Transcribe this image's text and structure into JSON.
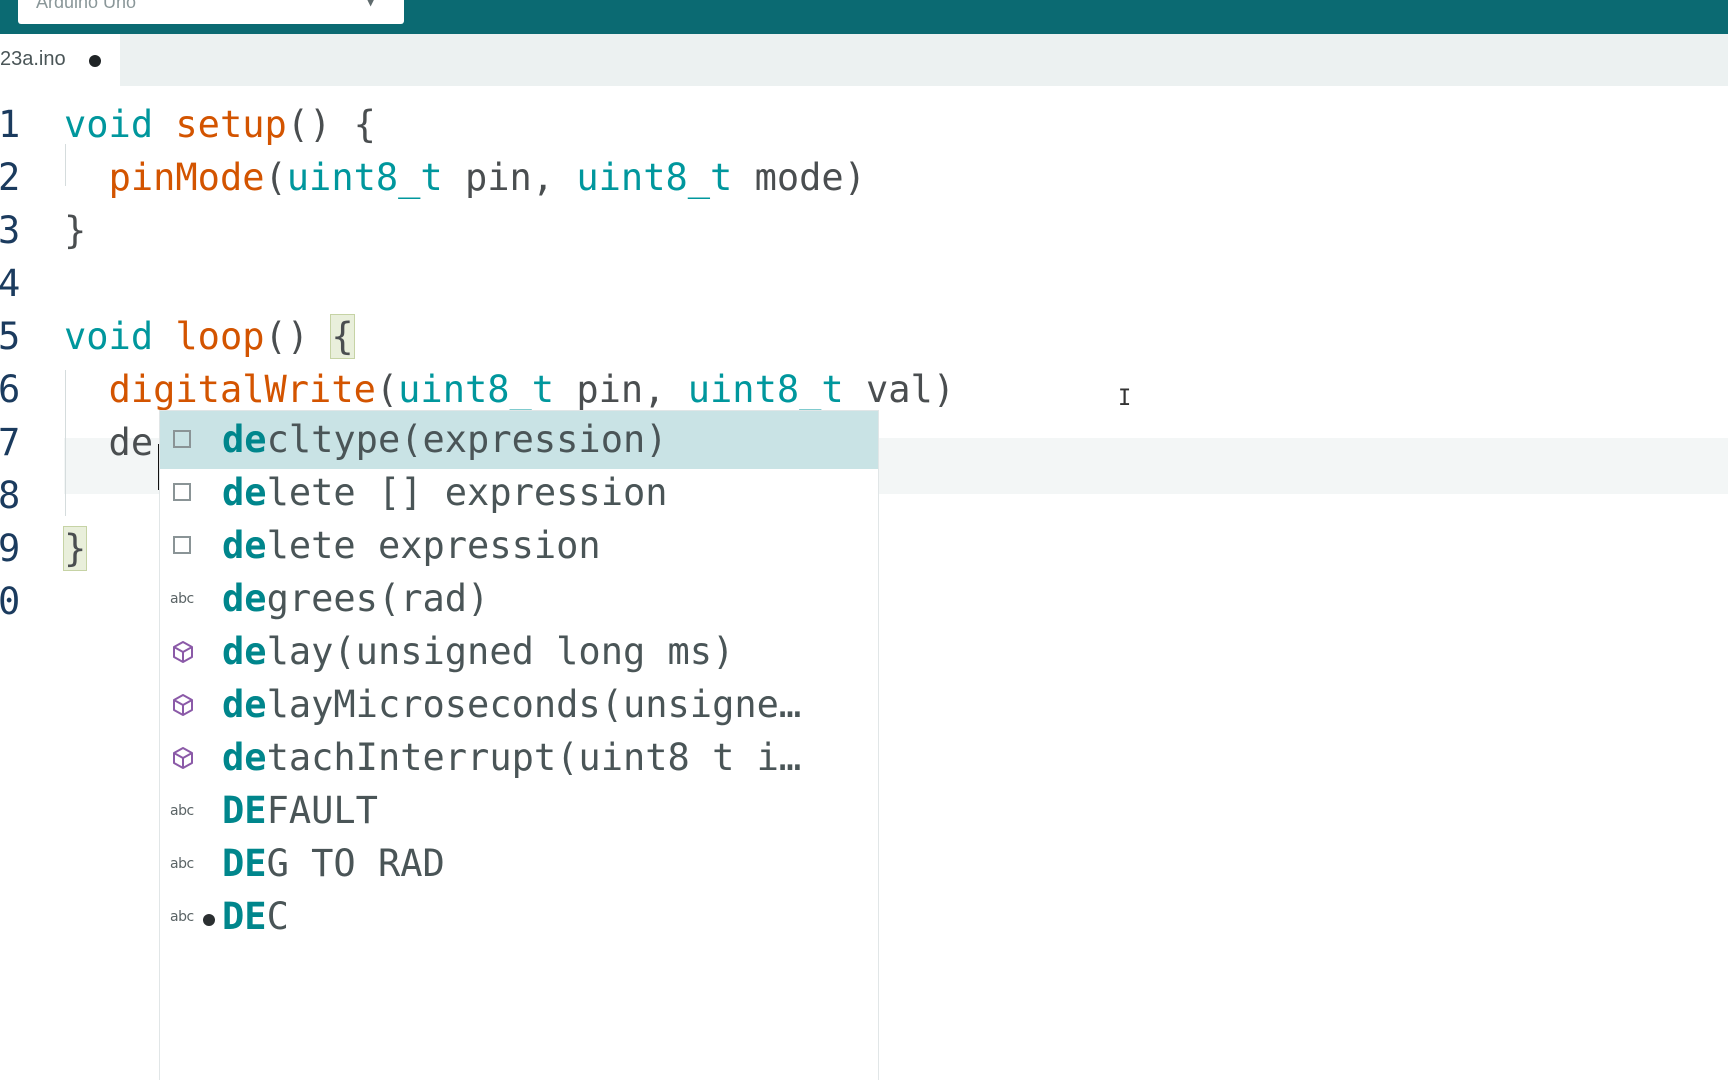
{
  "toolbar": {
    "board_label": "Arduino Uno"
  },
  "tabs": [
    {
      "label": "23a.ino",
      "modified": true
    }
  ],
  "editor": {
    "line_numbers": [
      "1",
      "2",
      "3",
      "4",
      "5",
      "6",
      "7",
      "8",
      "9",
      "0"
    ],
    "lines": [
      {
        "tokens": [
          {
            "t": "void",
            "c": "kw"
          },
          {
            "t": " ",
            "c": "tx"
          },
          {
            "t": "setup",
            "c": "fn"
          },
          {
            "t": "() {",
            "c": "tx"
          }
        ]
      },
      {
        "tokens": [
          {
            "t": "  ",
            "c": "tx"
          },
          {
            "t": "pinMode",
            "c": "fn"
          },
          {
            "t": "(",
            "c": "tx"
          },
          {
            "t": "uint8_t",
            "c": "ty"
          },
          {
            "t": " pin, ",
            "c": "tx"
          },
          {
            "t": "uint8_t",
            "c": "ty"
          },
          {
            "t": " mode)",
            "c": "tx"
          }
        ]
      },
      {
        "tokens": [
          {
            "t": "}",
            "c": "tx"
          }
        ]
      },
      {
        "tokens": []
      },
      {
        "tokens": [
          {
            "t": "void",
            "c": "kw"
          },
          {
            "t": " ",
            "c": "tx"
          },
          {
            "t": "loop",
            "c": "fn"
          },
          {
            "t": "() ",
            "c": "tx"
          },
          {
            "t": "{",
            "c": "tx br-match"
          }
        ]
      },
      {
        "tokens": [
          {
            "t": "  ",
            "c": "tx"
          },
          {
            "t": "digitalWrite",
            "c": "fn"
          },
          {
            "t": "(",
            "c": "tx"
          },
          {
            "t": "uint8_t",
            "c": "ty"
          },
          {
            "t": " pin, ",
            "c": "tx"
          },
          {
            "t": "uint8_t",
            "c": "ty"
          },
          {
            "t": " val)",
            "c": "tx"
          }
        ]
      },
      {
        "tokens": [
          {
            "t": "  de",
            "c": "tx"
          }
        ]
      },
      {
        "tokens": []
      },
      {
        "tokens": [
          {
            "t": "}",
            "c": "tx br-match"
          }
        ]
      },
      {
        "tokens": []
      }
    ]
  },
  "suggestions": [
    {
      "match": "de",
      "rest": "cltype(expression)",
      "icon": "keyword-icon",
      "selected": true
    },
    {
      "match": "de",
      "rest": "lete [] expression",
      "icon": "keyword-icon",
      "selected": false
    },
    {
      "match": "de",
      "rest": "lete expression",
      "icon": "keyword-icon",
      "selected": false
    },
    {
      "match": "de",
      "rest": "grees(rad)",
      "icon": "text-icon",
      "selected": false
    },
    {
      "match": "de",
      "rest": "lay(unsigned long ms)",
      "icon": "method-icon",
      "selected": false
    },
    {
      "match": "de",
      "rest": "layMicroseconds(unsigne…",
      "icon": "method-icon",
      "selected": false
    },
    {
      "match": "de",
      "rest": "tachInterrupt(uint8 t i…",
      "icon": "method-icon",
      "selected": false
    },
    {
      "match": "DE",
      "rest": "FAULT",
      "icon": "text-icon",
      "selected": false
    },
    {
      "match": "DE",
      "rest": "G TO RAD",
      "icon": "text-icon",
      "selected": false
    },
    {
      "match": "DE",
      "rest": "C",
      "icon": "text-icon",
      "selected": false,
      "bullet": true
    }
  ],
  "icon_text": {
    "text_icon_glyph": "abc"
  }
}
